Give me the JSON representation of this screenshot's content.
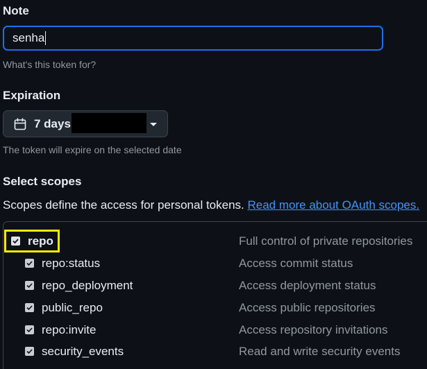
{
  "note": {
    "title": "Note",
    "value": "senha",
    "hint": "What's this token for?"
  },
  "expiration": {
    "title": "Expiration",
    "selected": "7 days",
    "hint": "The token will expire on the selected date"
  },
  "scopes": {
    "title": "Select scopes",
    "description": "Scopes define the access for personal tokens.",
    "link": "Read more about OAuth scopes.",
    "items": [
      {
        "name": "repo",
        "description": "Full control of private repositories",
        "checked": true
      },
      {
        "name": "repo:status",
        "description": "Access commit status",
        "checked": true
      },
      {
        "name": "repo_deployment",
        "description": "Access deployment status",
        "checked": true
      },
      {
        "name": "public_repo",
        "description": "Access public repositories",
        "checked": true
      },
      {
        "name": "repo:invite",
        "description": "Access repository invitations",
        "checked": true
      },
      {
        "name": "security_events",
        "description": "Read and write security events",
        "checked": true
      }
    ]
  },
  "colors": {
    "background": "#0d1117",
    "focus_border": "#1f6feb",
    "link": "#4493f8",
    "highlight": "#ffeb00",
    "muted_text": "#9198a1"
  },
  "icons": {
    "expiration": "calendar-icon",
    "dropdown": "caret-down-icon",
    "checkbox": "checkmark-icon"
  }
}
